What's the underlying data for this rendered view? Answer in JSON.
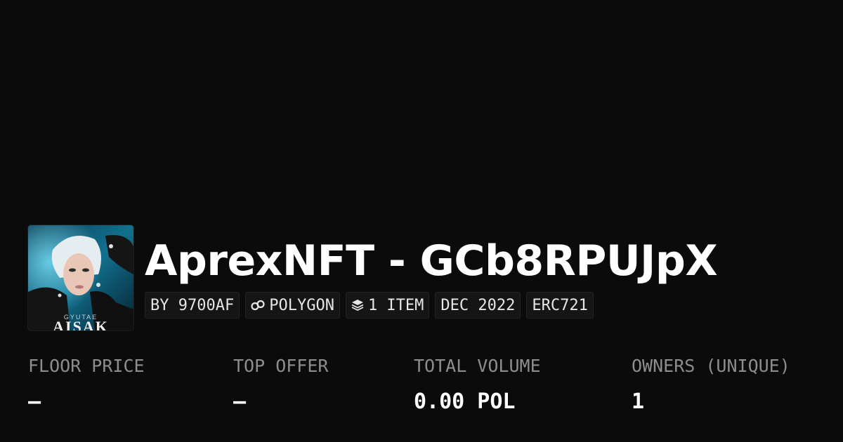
{
  "collection": {
    "title": "AprexNFT - GCb8RPUJpX",
    "thumbnail_caption": "AISAK",
    "thumbnail_subcaption": "GYUTAE"
  },
  "chips": {
    "creator": "BY 9700AF",
    "chain": "POLYGON",
    "chain_icon": "polygon-link-icon",
    "items": "1 ITEM",
    "items_icon": "layers-icon",
    "date": "DEC 2022",
    "standard": "ERC721"
  },
  "stats": {
    "floor_price": {
      "label": "FLOOR PRICE",
      "value": "–"
    },
    "top_offer": {
      "label": "TOP OFFER",
      "value": "–"
    },
    "total_volume": {
      "label": "TOTAL VOLUME",
      "value": "0.00 POL"
    },
    "owners": {
      "label": "OWNERS (UNIQUE)",
      "value": "1"
    }
  },
  "colors": {
    "background": "#0b0b0b",
    "chip_background": "#151515",
    "label": "#8d8d8d",
    "text": "#ffffff"
  }
}
